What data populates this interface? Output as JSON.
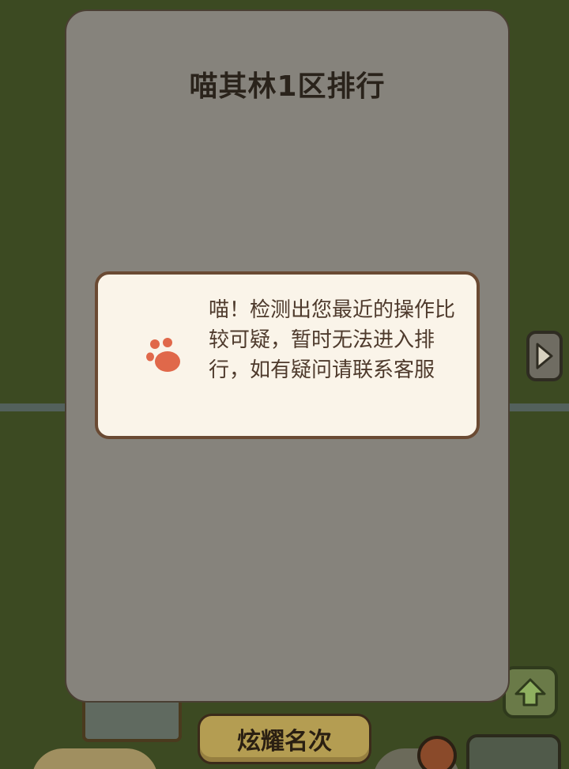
{
  "panel": {
    "title": "喵其林1区排行"
  },
  "dialog": {
    "icon": "paw-icon",
    "icon_color": "#e0684a",
    "message": "喵！检测出您最近的操作比较可疑，暂时无法进入排行，如有疑问请联系客服"
  },
  "footer": {
    "action_label": "炫耀名次"
  },
  "colors": {
    "panel_bg": "#86837c",
    "dialog_bg": "#faf4e9",
    "button_bg": "#b49d52",
    "scene_bg": "#3c4a22"
  }
}
